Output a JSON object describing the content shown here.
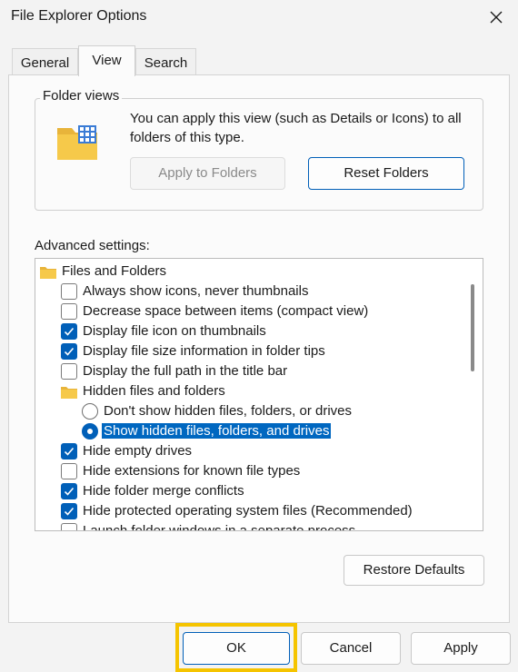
{
  "window": {
    "title": "File Explorer Options"
  },
  "tabs": [
    {
      "label": "General"
    },
    {
      "label": "View"
    },
    {
      "label": "Search"
    }
  ],
  "folder_views": {
    "legend": "Folder views",
    "description": "You can apply this view (such as Details or Icons) to all folders of this type.",
    "apply_button": "Apply to Folders",
    "reset_button": "Reset Folders"
  },
  "advanced": {
    "label": "Advanced settings:",
    "items": [
      {
        "kind": "folder",
        "label": "Files and Folders"
      },
      {
        "kind": "checkbox",
        "checked": false,
        "label": "Always show icons, never thumbnails"
      },
      {
        "kind": "checkbox",
        "checked": false,
        "label": "Decrease space between items (compact view)"
      },
      {
        "kind": "checkbox",
        "checked": true,
        "label": "Display file icon on thumbnails"
      },
      {
        "kind": "checkbox",
        "checked": true,
        "label": "Display file size information in folder tips"
      },
      {
        "kind": "checkbox",
        "checked": false,
        "label": "Display the full path in the title bar"
      },
      {
        "kind": "folder",
        "label": "Hidden files and folders"
      },
      {
        "kind": "radio",
        "checked": false,
        "label": "Don't show hidden files, folders, or drives"
      },
      {
        "kind": "radio",
        "checked": true,
        "selected": true,
        "label": "Show hidden files, folders, and drives"
      },
      {
        "kind": "checkbox",
        "checked": true,
        "label": "Hide empty drives"
      },
      {
        "kind": "checkbox",
        "checked": false,
        "label": "Hide extensions for known file types"
      },
      {
        "kind": "checkbox",
        "checked": true,
        "label": "Hide folder merge conflicts"
      },
      {
        "kind": "checkbox",
        "checked": true,
        "label": "Hide protected operating system files (Recommended)"
      },
      {
        "kind": "checkbox",
        "checked": false,
        "label": "Launch folder windows in a separate process"
      }
    ]
  },
  "restore_button": "Restore Defaults",
  "footer": {
    "ok": "OK",
    "cancel": "Cancel",
    "apply": "Apply"
  },
  "colors": {
    "accent": "#005fb8",
    "highlight_frame": "#f5c400",
    "folder": "#f6c94a"
  }
}
